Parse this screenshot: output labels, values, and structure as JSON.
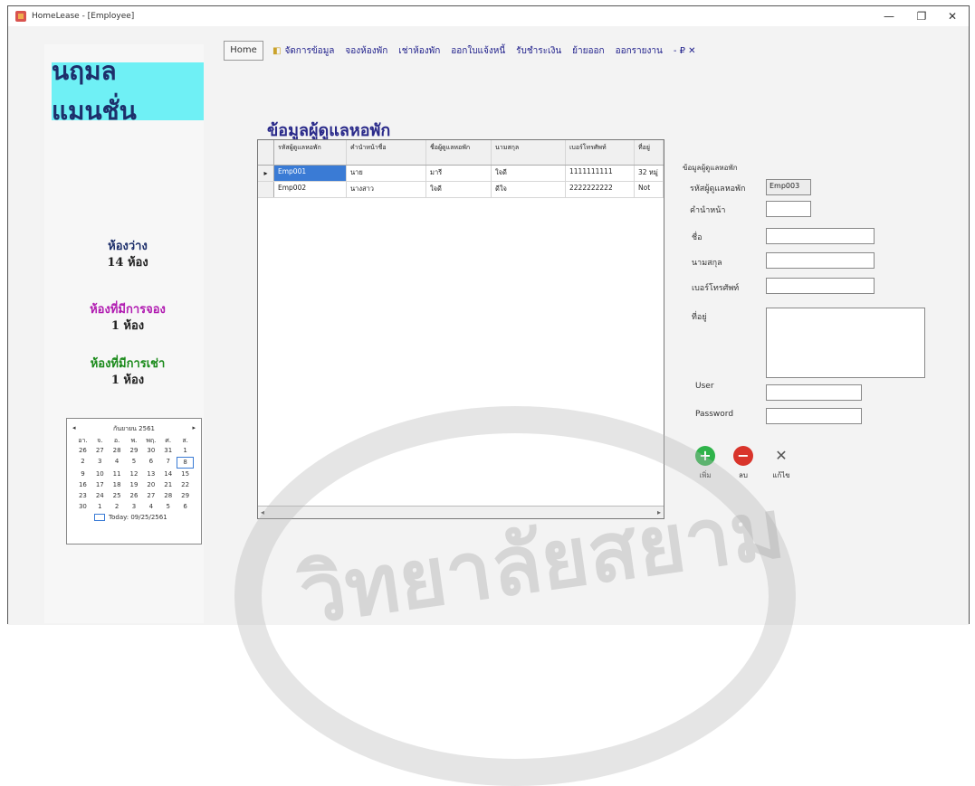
{
  "window": {
    "title": "HomeLease - [Employee]",
    "minimize": "—",
    "restore": "❐",
    "close": "✕"
  },
  "sidebar": {
    "logo_text": "นฤมล แมนชั่น",
    "stats": [
      {
        "label": "ห้องว่าง",
        "value": "14 ห้อง",
        "color": "#1d2f6b"
      },
      {
        "label": "ห้องที่มีการจอง",
        "value": "1 ห้อง",
        "color": "#b11cb1"
      },
      {
        "label": "ห้องที่มีการเช่า",
        "value": "1 ห้อง",
        "color": "#1a8a1a"
      }
    ],
    "calendar": {
      "month_label": "กันยายน 2561",
      "prev": "◂",
      "next": "▸",
      "weekdays": [
        "อา.",
        "จ.",
        "อ.",
        "พ.",
        "พฤ.",
        "ศ.",
        "ส."
      ],
      "days": [
        "26",
        "27",
        "28",
        "29",
        "30",
        "31",
        "1",
        "2",
        "3",
        "4",
        "5",
        "6",
        "7",
        "8",
        "9",
        "10",
        "11",
        "12",
        "13",
        "14",
        "15",
        "16",
        "17",
        "18",
        "19",
        "20",
        "21",
        "22",
        "23",
        "24",
        "25",
        "26",
        "27",
        "28",
        "29",
        "30",
        "1",
        "2",
        "3",
        "4",
        "5",
        "6"
      ],
      "selected_index": 13,
      "today_label": "Today: 09/25/2561"
    }
  },
  "menubar": {
    "home": "Home",
    "items": [
      "จัดการข้อมูล",
      "จองห้องพัก",
      "เช่าห้องพัก",
      "ออกใบแจ้งหนี้",
      "รับชำระเงิน",
      "ย้ายออก",
      "ออกรายงาน"
    ],
    "tail": "- ₽ ✕"
  },
  "page": {
    "title": "ข้อมูลผู้ดูแลหอพัก"
  },
  "grid": {
    "columns": [
      "รหัสผู้ดูแลหอพัก",
      "คำนำหน้าชื่อ",
      "ชื่อผู้ดูแลหอพัก",
      "นามสกุล",
      "เบอร์โทรศัพท์",
      "ที่อยู่"
    ],
    "rows": [
      [
        "Emp001",
        "นาย",
        "มารี",
        "ใจดี",
        "1111111111",
        "32 หมู่"
      ],
      [
        "Emp002",
        "นางสาว",
        "ใจดี",
        "ดีใจ",
        "2222222222",
        "Not"
      ]
    ],
    "scroll_left": "◂",
    "scroll_right": "▸"
  },
  "form": {
    "group_caption": "ข้อมูลผู้ดูแลหอพัก",
    "fields": [
      {
        "label": "รหัสผู้ดูแลหอพัก",
        "value": "Emp003"
      },
      {
        "label": "คำนำหน้า",
        "value": ""
      },
      {
        "label": "ชื่อ",
        "value": ""
      },
      {
        "label": "นามสกุล",
        "value": ""
      },
      {
        "label": "เบอร์โทรศัพท์",
        "value": ""
      },
      {
        "label": "ที่อยู่",
        "value": ""
      },
      {
        "label": "User",
        "value": ""
      },
      {
        "label": "Password",
        "value": ""
      }
    ],
    "buttons": [
      {
        "label": "เพิ่ม",
        "glyph": "+",
        "color": "#2fb34a"
      },
      {
        "label": "ลบ",
        "glyph": "−",
        "color": "#d9342b"
      },
      {
        "label": "แก้ไข",
        "glyph": "✕",
        "color": "#555555"
      }
    ]
  },
  "watermark": {
    "text": "วิทยาลัยสยาม"
  }
}
